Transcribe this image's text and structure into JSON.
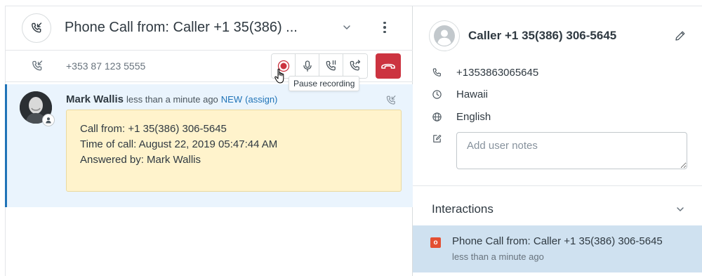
{
  "conversation": {
    "title": "Phone Call from: Caller +1 35(386) ...",
    "call_bar": {
      "number": "+353 87 123 5555",
      "controls": [
        {
          "name": "record-button",
          "icon": "record-icon"
        },
        {
          "name": "mute-button",
          "icon": "microphone-icon"
        },
        {
          "name": "hold-button",
          "icon": "phone-pause-icon"
        },
        {
          "name": "transfer-button",
          "icon": "phone-forward-icon"
        }
      ],
      "end_call_color": "#cc3340"
    },
    "tooltip": "Pause recording",
    "event": {
      "author": "Mark Wallis",
      "time": "less than a minute ago",
      "status": "NEW",
      "assign": "(assign)",
      "lines": [
        "Call from: +1 35(386) 306-5645",
        "Time of call: August 22, 2019 05:47:44 AM",
        "Answered by: Mark Wallis"
      ]
    }
  },
  "profile": {
    "name": "Caller +1 35(386) 306-5645",
    "phone": "+1353863065645",
    "timezone": "Hawaii",
    "language": "English",
    "notes_placeholder": "Add user notes"
  },
  "interactions": {
    "title": "Interactions",
    "items": [
      {
        "badge": "o",
        "title": "Phone Call from: Caller +1 35(386) 306-5645",
        "time": "less than a minute ago"
      }
    ]
  },
  "colors": {
    "accent": "#1f73b7",
    "event_bg": "#eaf4fd",
    "note_bg": "#fff3cc",
    "selected_bg": "#cfe1f0",
    "badge": "#e34f32"
  }
}
